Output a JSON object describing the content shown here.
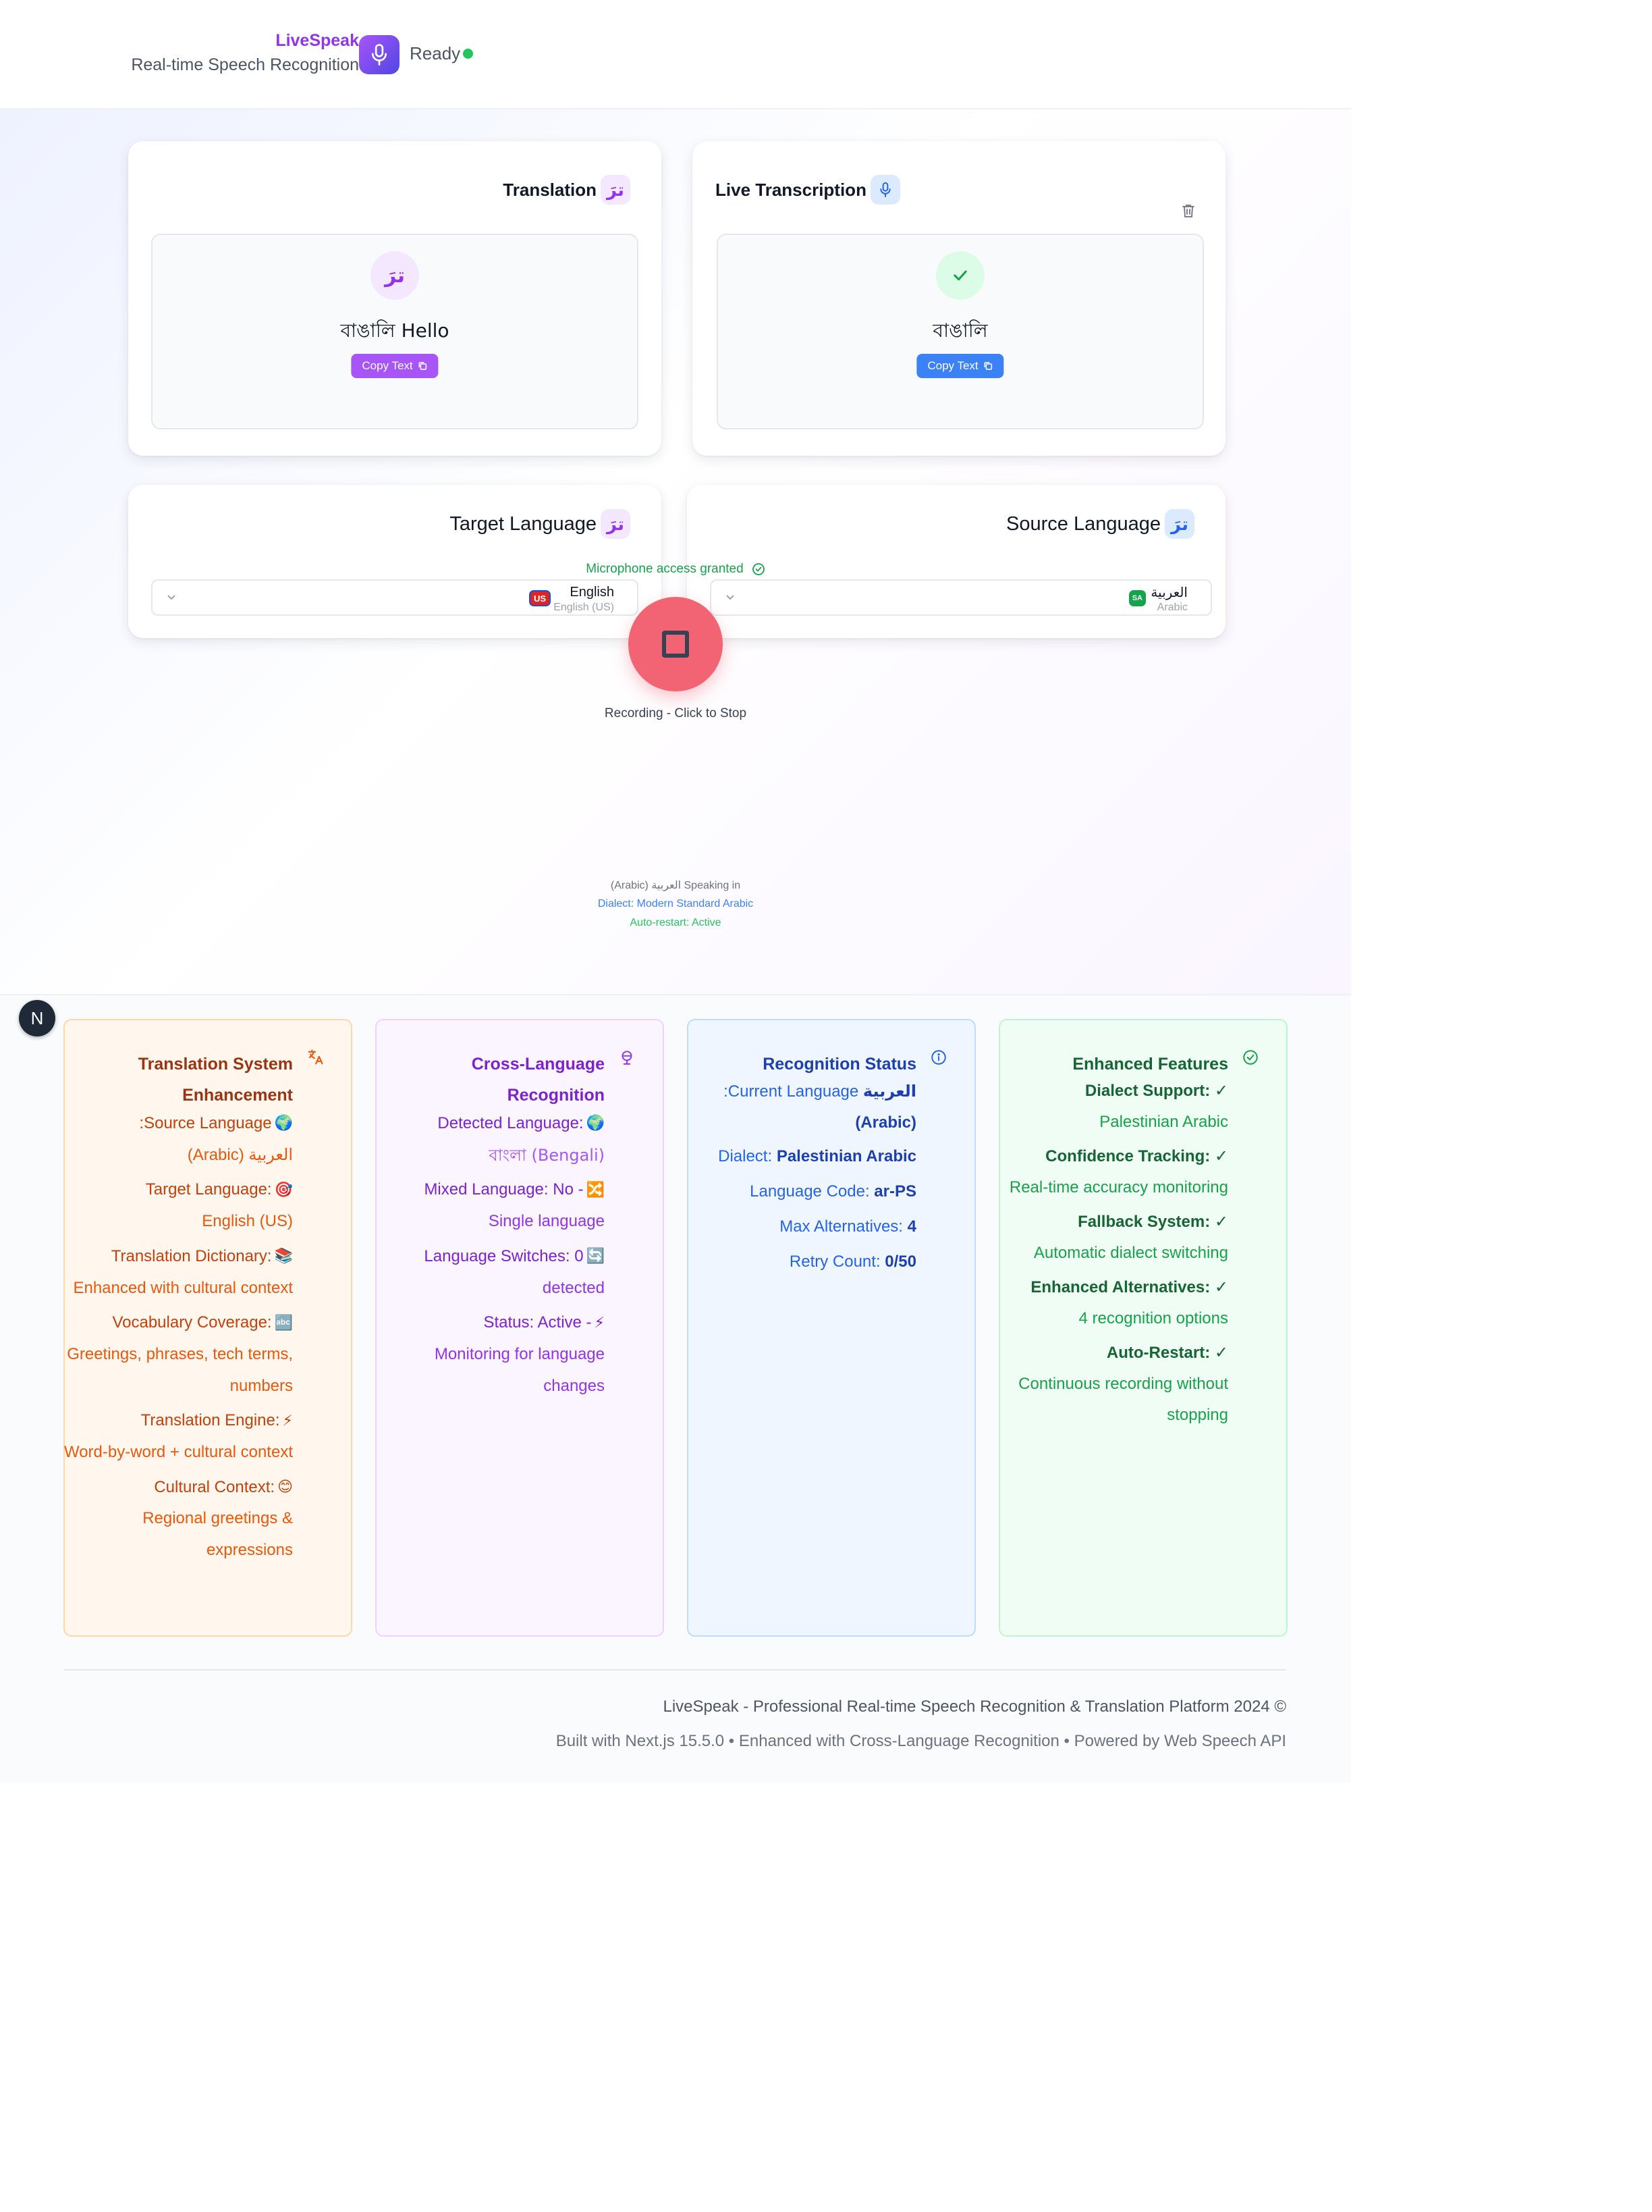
{
  "header": {
    "app_name": "LiveSpeak",
    "subtitle": "Real-time Speech Recognition",
    "status": "Ready"
  },
  "translation_card": {
    "title": "Translation",
    "chip_glyph": "ترَ",
    "icon_glyph": "ترَ",
    "text": "বাঙালি Hello",
    "copy_label": "Copy Text"
  },
  "transcription_card": {
    "title": "Live Transcription",
    "text": "বাঙালি",
    "copy_label": "Copy Text"
  },
  "target_language": {
    "title": "Target Language",
    "flag": "US",
    "name": "English",
    "sub": "English (US)"
  },
  "source_language": {
    "title": "Source Language",
    "flag": "SA",
    "name": "العربية",
    "sub": "Arabic"
  },
  "recorder": {
    "mic_status": "Microphone access granted",
    "label": "Recording - Click to Stop",
    "speaking": "(Arabic) العربية Speaking in",
    "dialect": "Dialect: Modern Standard Arabic",
    "auto_restart": "Auto-restart: Active"
  },
  "next_badge": "N",
  "panels": {
    "translation_system": {
      "title": "Translation System Enhancement",
      "rows": [
        {
          "label": ":Source Language",
          "emoji": "🌍",
          "value": "(Arabic) العربية"
        },
        {
          "label": "Target Language:",
          "emoji": "🎯",
          "value": "English (US)"
        },
        {
          "label": "Translation Dictionary:",
          "emoji": "📚",
          "value": "Enhanced with cultural context"
        },
        {
          "label": "Vocabulary Coverage:",
          "emoji": "🔤",
          "value": "Greetings, phrases, tech terms, numbers"
        },
        {
          "label": "Translation Engine:",
          "emoji": "⚡",
          "value": "Word-by-word + cultural context"
        },
        {
          "label": "Cultural Context:",
          "emoji": "😊",
          "value": "Regional greetings & expressions"
        }
      ]
    },
    "cross_language": {
      "title": "Cross-Language Recognition",
      "rows": [
        {
          "label": "Detected Language:",
          "emoji": "🌍",
          "value": "বাংলা (Bengali)"
        },
        {
          "label": "Mixed Language: No -",
          "emoji": "🔀",
          "value": "Single language"
        },
        {
          "label": "Language Switches: 0",
          "emoji": "🔄",
          "value": "detected"
        },
        {
          "label": "Status: Active -",
          "emoji": "⚡",
          "value": "Monitoring for language changes"
        }
      ]
    },
    "recognition_status": {
      "title": "Recognition Status",
      "current_language_label": ":Current Language",
      "current_language_value": "العربية",
      "current_language_suffix": "(Arabic)",
      "dialect_label": "Dialect:",
      "dialect_value": "Palestinian Arabic",
      "code_label": "Language Code:",
      "code_value": "ar-PS",
      "max_alt_label": "Max Alternatives:",
      "max_alt_value": "4",
      "retry_label": "Retry Count:",
      "retry_value": "0/50"
    },
    "enhanced_features": {
      "title": "Enhanced Features",
      "rows": [
        {
          "label": "Dialect Support: ✓",
          "value": "Palestinian Arabic"
        },
        {
          "label": "Confidence Tracking: ✓",
          "value": "Real-time accuracy monitoring"
        },
        {
          "label": "Fallback System: ✓",
          "value": "Automatic dialect switching"
        },
        {
          "label": "Enhanced Alternatives: ✓",
          "value": "4 recognition options"
        },
        {
          "label": "Auto-Restart: ✓",
          "value": "Continuous recording without stopping"
        }
      ]
    }
  },
  "footer": {
    "line1": "LiveSpeak - Professional Real-time Speech Recognition & Translation Platform 2024 ©",
    "line2": "Built with Next.js 15.5.0 • Enhanced with Cross-Language Recognition • Powered by Web Speech API"
  }
}
